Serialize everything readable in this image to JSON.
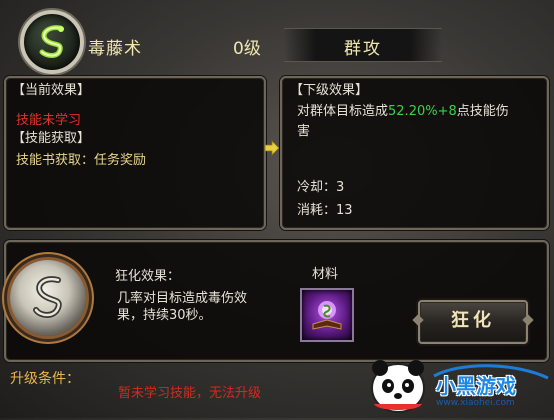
{
  "header": {
    "skill_name": "毒藤术",
    "level": "0级",
    "skill_type": "群攻",
    "skill_icon": "poison-vine-icon"
  },
  "current_panel": {
    "current_effect_heading": "【当前效果】",
    "current_effect_text": "技能未学习",
    "acquire_heading": "【技能获取】",
    "acquire_text": "技能书获取：任务奖励"
  },
  "next_panel": {
    "heading": "【下级效果】",
    "desc_prefix": "对群体目标造成",
    "desc_percent": "52.20%",
    "desc_plus": "+8",
    "desc_suffix": "点技能伤",
    "desc_line2": "害",
    "cooldown": "冷却：3",
    "cost": "消耗：13"
  },
  "berserk": {
    "title": "狂化效果：",
    "desc_line1": "几率对目标造成毒伤效",
    "desc_line2": "果，持续30秒。",
    "material_label": "材料",
    "button_label": "狂化",
    "material_icon": "purple-orb-book-icon"
  },
  "footer": {
    "upgrade_label": "升级条件：",
    "upgrade_message": "暂未学习技能，无法升级"
  },
  "watermark": {
    "text": "小黑游戏",
    "url": "www.xiaohei.com"
  },
  "colors": {
    "title_text": "#f0e6b0",
    "red_text": "#e0302a",
    "green_value": "#3bd04a",
    "yellow_text": "#e8d58a",
    "panel_border": "#6d665a"
  }
}
